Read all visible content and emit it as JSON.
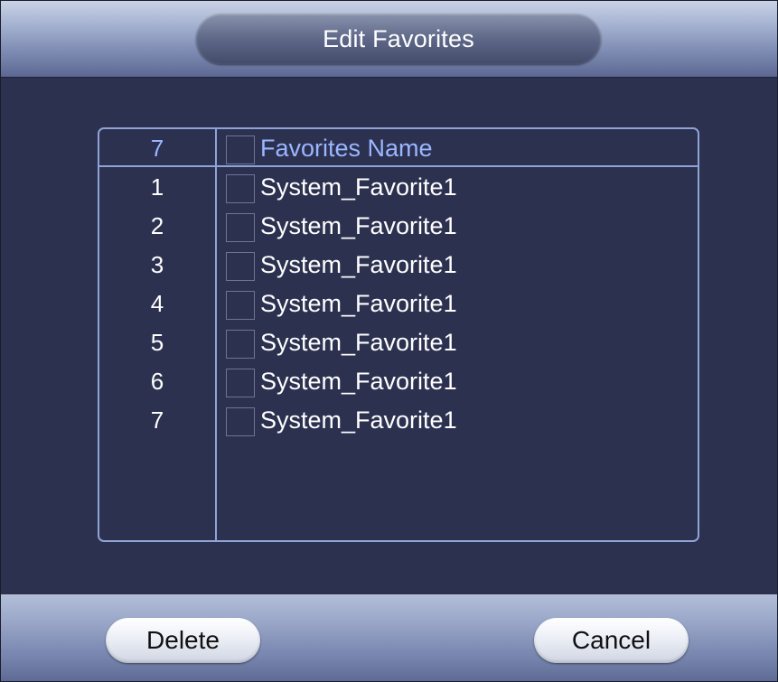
{
  "dialog": {
    "title": "Edit Favorites"
  },
  "list": {
    "header": {
      "count": "7",
      "column_name": "Favorites Name"
    },
    "rows": [
      {
        "index": "1",
        "name": "System_Favorite1"
      },
      {
        "index": "2",
        "name": "System_Favorite1"
      },
      {
        "index": "3",
        "name": "System_Favorite1"
      },
      {
        "index": "4",
        "name": "System_Favorite1"
      },
      {
        "index": "5",
        "name": "System_Favorite1"
      },
      {
        "index": "6",
        "name": "System_Favorite1"
      },
      {
        "index": "7",
        "name": "System_Favorite1"
      }
    ]
  },
  "footer": {
    "delete_label": "Delete",
    "cancel_label": "Cancel"
  },
  "colors": {
    "background": "#2c3150",
    "border_accent": "#8fa3d6",
    "header_text": "#9ab6ff",
    "row_text": "#ffffff"
  }
}
